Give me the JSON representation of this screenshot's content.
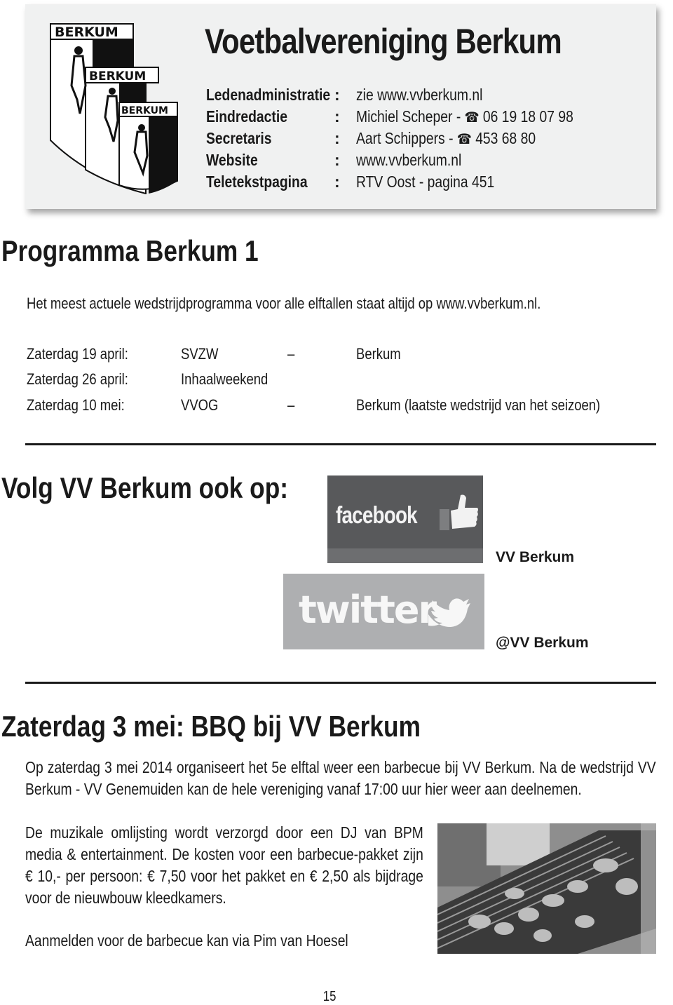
{
  "header": {
    "logo_text": "BERKUM",
    "title": "Voetbalvereniging Berkum",
    "info": [
      {
        "label": "Ledenadministratie",
        "colon": ":",
        "value": "zie www.vvberkum.nl",
        "phone": ""
      },
      {
        "label": "Eindredactie",
        "colon": ":",
        "value": "Michiel Scheper - ",
        "phone": "06 19 18 07 98"
      },
      {
        "label": "Secretaris",
        "colon": ":",
        "value": "Aart Schippers - ",
        "phone": "453 68 80"
      },
      {
        "label": "Website",
        "colon": ":",
        "value": "www.vvberkum.nl",
        "phone": ""
      },
      {
        "label": "Teletekstpagina",
        "colon": ":",
        "value": "RTV Oost - pagina 451",
        "phone": ""
      }
    ],
    "phone_icon": "☎"
  },
  "programma": {
    "title": "Programma Berkum 1",
    "intro": "Het meest actuele wedstrijdprogramma voor alle elftallen staat altijd op www.vvberkum.nl.",
    "matches": [
      {
        "date": "Zaterdag 19 april:",
        "home": "SVZW",
        "dash": "–",
        "away": "Berkum"
      },
      {
        "date": "Zaterdag 26 april:",
        "home": "Inhaalweekend",
        "dash": "",
        "away": ""
      },
      {
        "date": "Zaterdag 10 mei:",
        "home": "VVOG",
        "dash": "–",
        "away": "Berkum (laatste wedstrijd van het seizoen)"
      }
    ]
  },
  "social": {
    "title": "Volg VV Berkum ook op:",
    "facebook": {
      "logo_text": "facebook",
      "handle": "VV Berkum"
    },
    "twitter": {
      "logo_text": "twitter",
      "handle": "@VV Berkum"
    }
  },
  "bbq": {
    "title": "Zaterdag 3 mei: BBQ bij VV Berkum",
    "paragraph1": "Op zaterdag 3 mei 2014 organiseert het 5e elftal weer een barbecue bij VV Berkum. Na de wedstrijd VV Berkum - VV Genemuiden kan de hele vereniging vanaf 17:00 uur hier weer aan deelnemen.",
    "paragraph2": "De muzikale omlijsting wordt verzorgd door een DJ van BPM media & entertainment. De kosten voor een barbecue-pakket zijn € 10,- per persoon: € 7,50 voor het pakket en € 2,50 als bijdrage voor de nieuwbouw kleedkamers.",
    "signup": "Aanmelden voor de barbecue kan via Pim van Hoesel",
    "photo_alt": "barbecue grill with skewers"
  },
  "footer": {
    "page_number": "15"
  }
}
